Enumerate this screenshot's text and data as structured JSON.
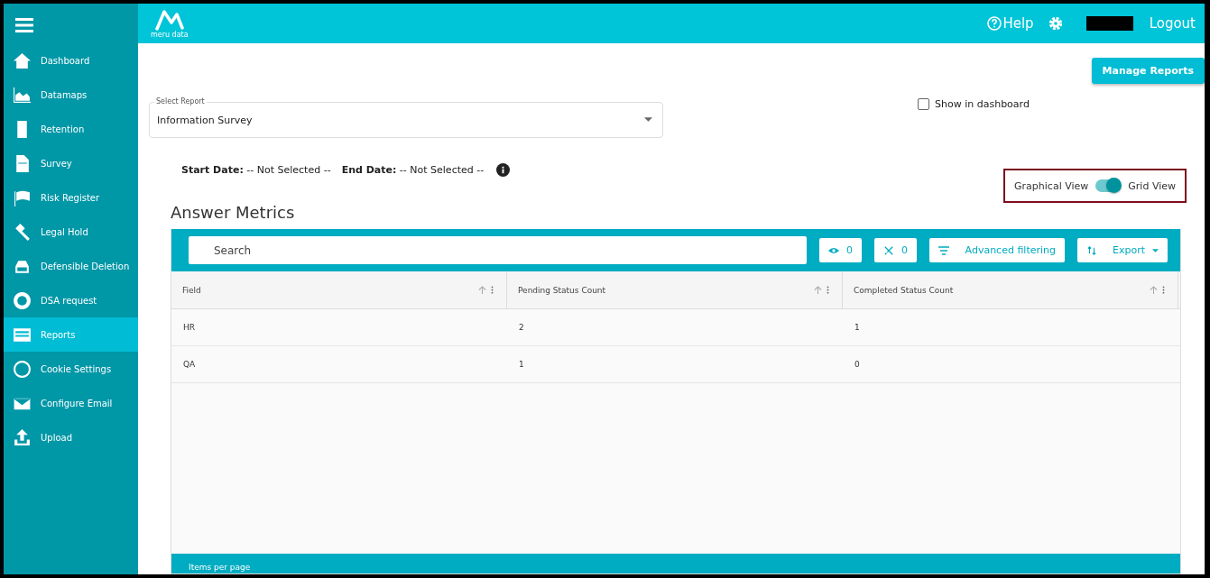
{
  "sidebar": {
    "items": [
      {
        "label": "Dashboard",
        "selected": false
      },
      {
        "label": "Datamaps",
        "selected": false
      },
      {
        "label": "Retention",
        "selected": false
      },
      {
        "label": "Survey",
        "selected": false
      },
      {
        "label": "Risk Register",
        "selected": false
      },
      {
        "label": "Legal Hold",
        "selected": false
      },
      {
        "label": "Defensible Deletion",
        "selected": false
      },
      {
        "label": "DSA request",
        "selected": false
      },
      {
        "label": "Reports",
        "selected": true
      },
      {
        "label": "Cookie Settings",
        "selected": false
      },
      {
        "label": "Configure Email",
        "selected": false
      },
      {
        "label": "Upload",
        "selected": false
      }
    ]
  },
  "header": {
    "logo_text": "meru data",
    "help": "Help",
    "logout": "Logout"
  },
  "manage_button": "Manage Reports",
  "select_report": {
    "label": "Select Report",
    "value": "Information Survey"
  },
  "show_in_dashboard": {
    "label": "Show in dashboard",
    "checked": false
  },
  "dates": {
    "start_label": "Start Date:",
    "start_value": "-- Not Selected --",
    "end_label": "End Date:",
    "end_value": "-- Not Selected --"
  },
  "view_toggle": {
    "left": "Graphical View",
    "right": "Grid View",
    "on": true
  },
  "section_title": "Answer Metrics",
  "grid": {
    "search_placeholder": "Search",
    "hidden_count": "0",
    "pinned_count": "0",
    "filter_button": "Advanced filtering",
    "export_button": "Export",
    "columns": [
      "Field",
      "Pending Status Count",
      "Completed Status Count"
    ],
    "rows": [
      [
        "HR",
        "2",
        "1"
      ],
      [
        "QA",
        "1",
        "0"
      ]
    ],
    "footer": "Items per page"
  }
}
